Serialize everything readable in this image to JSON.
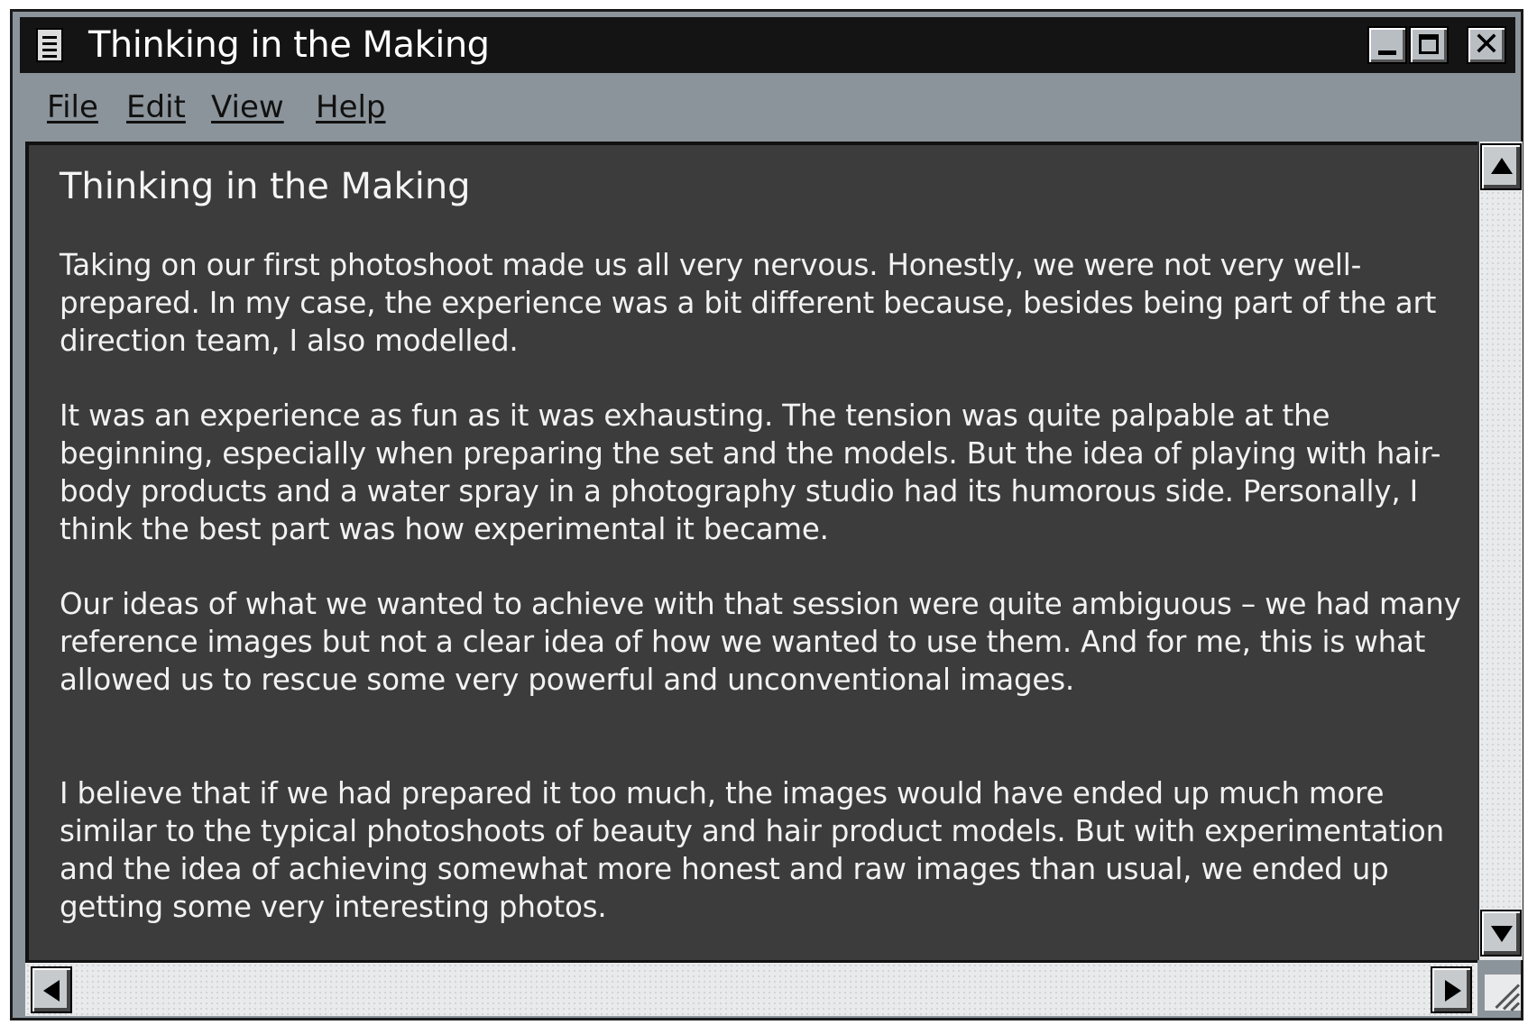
{
  "window": {
    "title": "Thinking in the Making",
    "controls": [
      "minimize-icon",
      "maximize-icon",
      "close-icon"
    ],
    "close_glyph": "✕"
  },
  "menu": {
    "items": [
      {
        "label": "File"
      },
      {
        "label": "Edit"
      },
      {
        "label": "View"
      },
      {
        "label": "Help"
      }
    ]
  },
  "document": {
    "title": "Thinking in the Making",
    "paragraphs": [
      "Taking on our first photoshoot made us all very nervous. Honestly, we were not very well-prepared. In my case, the experience was a bit different because, besides being part of the art direction team, I also modelled.",
      "It was an experience as fun as it was exhausting. The tension was quite palpable at the beginning, especially when preparing the set and the models. But the idea of playing with hair-body products and a water spray in a photography studio had its humorous side. Personally, I think the best part was how experimental it became.",
      "Our ideas of what we wanted to achieve with that session were quite ambiguous – we had many reference images but not a clear idea of how we wanted to use them. And for me, this is what allowed us to rescue some very powerful and unconventional images.",
      "I believe that if we had prepared it too much, the images would have ended up much more similar to the typical photoshoots of beauty and hair product models. But with experimentation and the idea of achieving somewhat more honest and raw images than usual, we ended up getting some very interesting photos."
    ]
  },
  "scrollbars": {
    "vertical": {
      "up_icon": "arrow-up-icon",
      "down_icon": "arrow-down-icon"
    },
    "horizontal": {
      "left_icon": "arrow-left-icon",
      "right_icon": "arrow-right-icon"
    }
  },
  "colors": {
    "titlebar": "#141414",
    "window_frame": "#8c949b",
    "content_background": "#3c3c3d",
    "content_text": "#f2f2f2"
  }
}
